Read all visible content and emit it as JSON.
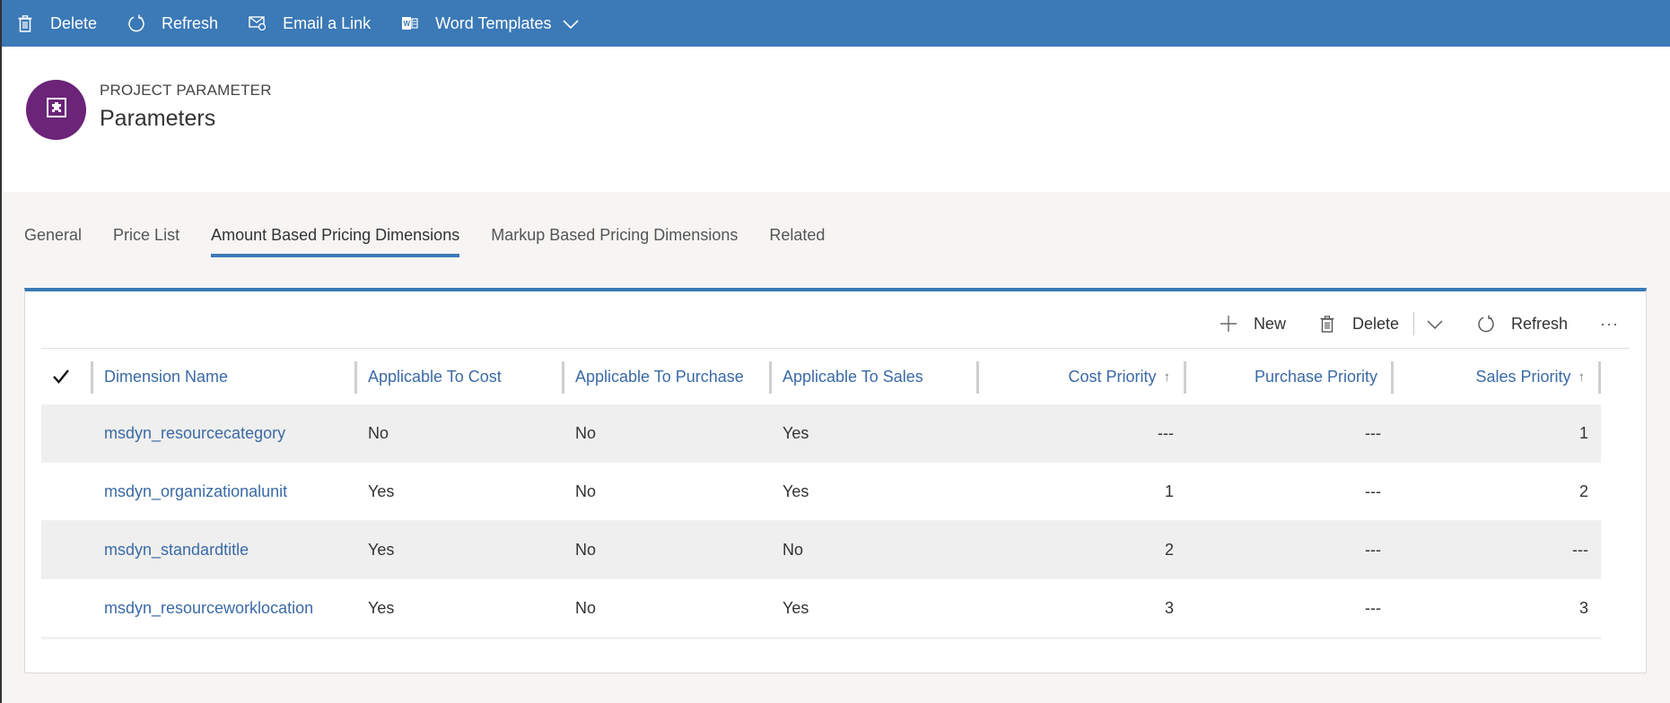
{
  "toolbar": {
    "buttons": [
      {
        "label": "Delete",
        "icon": "trash-icon"
      },
      {
        "label": "Refresh",
        "icon": "refresh-icon"
      },
      {
        "label": "Email a Link",
        "icon": "email-link-icon"
      },
      {
        "label": "Word Templates",
        "icon": "word-icon"
      }
    ],
    "color": "#3b79b7"
  },
  "header": {
    "entity_type": "PROJECT PARAMETER",
    "title": "Parameters",
    "avatar_color": "#6b2478"
  },
  "tabs": [
    {
      "label": "General",
      "active": false
    },
    {
      "label": "Price List",
      "active": false
    },
    {
      "label": "Amount Based Pricing Dimensions",
      "active": true
    },
    {
      "label": "Markup Based Pricing Dimensions",
      "active": false
    },
    {
      "label": "Related",
      "active": false
    }
  ],
  "subgrid": {
    "commands": {
      "new": "New",
      "delete": "Delete",
      "refresh": "Refresh",
      "more": "···"
    },
    "columns": [
      {
        "label": "Dimension Name"
      },
      {
        "label": "Applicable To Cost"
      },
      {
        "label": "Applicable To Purchase"
      },
      {
        "label": "Applicable To Sales"
      },
      {
        "label": "Cost Priority",
        "sorted": "ascending"
      },
      {
        "label": "Purchase Priority"
      },
      {
        "label": "Sales Priority",
        "sorted": "ascending"
      }
    ],
    "sort_arrow": "↑",
    "rows": [
      {
        "name": "msdyn_resourcecategory",
        "cost": "No",
        "purchase": "No",
        "sales": "Yes",
        "cost_priority": "---",
        "purchase_priority": "---",
        "sales_priority": "1"
      },
      {
        "name": "msdyn_organizationalunit",
        "cost": "Yes",
        "purchase": "No",
        "sales": "Yes",
        "cost_priority": "1",
        "purchase_priority": "---",
        "sales_priority": "2"
      },
      {
        "name": "msdyn_standardtitle",
        "cost": "Yes",
        "purchase": "No",
        "sales": "No",
        "cost_priority": "2",
        "purchase_priority": "---",
        "sales_priority": "---"
      },
      {
        "name": "msdyn_resourceworklocation",
        "cost": "Yes",
        "purchase": "No",
        "sales": "Yes",
        "cost_priority": "3",
        "purchase_priority": "---",
        "sales_priority": "3"
      }
    ]
  }
}
